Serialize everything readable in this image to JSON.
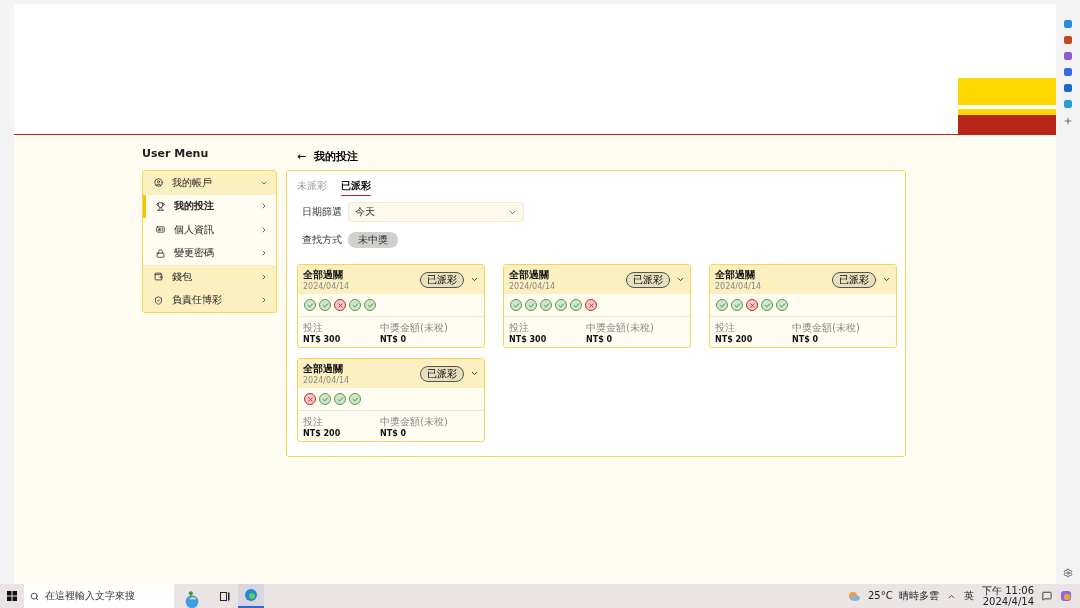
{
  "sidebar": {
    "title": "User Menu",
    "items": [
      {
        "label": "我的帳戶",
        "expanded": true,
        "selected": false,
        "children": [
          {
            "label": "我的投注",
            "selected": true
          },
          {
            "label": "個人資訊",
            "selected": false
          },
          {
            "label": "變更密碼",
            "selected": false
          }
        ]
      },
      {
        "label": "錢包",
        "expanded": false,
        "selected": false
      },
      {
        "label": "負責任博彩",
        "expanded": false,
        "selected": false
      }
    ]
  },
  "page": {
    "back": "←",
    "title": "我的投注"
  },
  "tabs": [
    {
      "label": "未派彩",
      "selected": false
    },
    {
      "label": "已派彩",
      "selected": true
    }
  ],
  "filters": {
    "date_label": "日期篩選",
    "date_value": "今天",
    "method_label": "查找方式",
    "method_chip": "未中獎"
  },
  "bets": [
    {
      "title": "全部過關",
      "date": "2024/04/14",
      "status": "已派彩",
      "results": [
        {
          "kind": "win"
        },
        {
          "kind": "win"
        },
        {
          "kind": "lose"
        },
        {
          "kind": "win"
        },
        {
          "kind": "win"
        }
      ],
      "stake_label": "投注",
      "stake": "NT$ 300",
      "prize_label": "中獎金額(未稅)",
      "prize": "NT$ 0"
    },
    {
      "title": "全部過關",
      "date": "2024/04/14",
      "status": "已派彩",
      "results": [
        {
          "kind": "win"
        },
        {
          "kind": "win"
        },
        {
          "kind": "win"
        },
        {
          "kind": "win"
        },
        {
          "kind": "win"
        },
        {
          "kind": "lose"
        }
      ],
      "stake_label": "投注",
      "stake": "NT$ 300",
      "prize_label": "中獎金額(未稅)",
      "prize": "NT$ 0"
    },
    {
      "title": "全部過關",
      "date": "2024/04/14",
      "status": "已派彩",
      "results": [
        {
          "kind": "win"
        },
        {
          "kind": "win"
        },
        {
          "kind": "lose"
        },
        {
          "kind": "win"
        },
        {
          "kind": "win"
        }
      ],
      "stake_label": "投注",
      "stake": "NT$ 200",
      "prize_label": "中獎金額(未稅)",
      "prize": "NT$ 0"
    },
    {
      "title": "全部過關",
      "date": "2024/04/14",
      "status": "已派彩",
      "results": [
        {
          "kind": "lose"
        },
        {
          "kind": "win"
        },
        {
          "kind": "win"
        },
        {
          "kind": "win"
        }
      ],
      "stake_label": "投注",
      "stake": "NT$ 200",
      "prize_label": "中獎金額(未稅)",
      "prize": "NT$ 0"
    }
  ],
  "taskbar": {
    "search_placeholder": "在這裡輸入文字來搜",
    "weather": "25°C  晴時多雲",
    "ime": "英",
    "time": "下午 11:06",
    "date": "2024/4/14"
  }
}
